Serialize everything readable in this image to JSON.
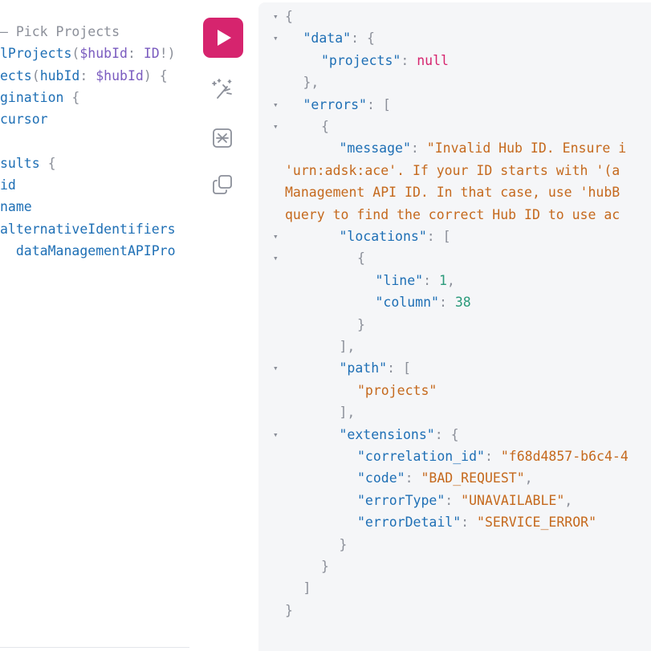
{
  "editor": {
    "lines": [
      {
        "segments": [
          {
            "t": "– Pick Projects",
            "c": "cmt"
          }
        ]
      },
      {
        "segments": [
          {
            "t": "lProjects",
            "c": "fn"
          },
          {
            "t": "(",
            "c": "p"
          },
          {
            "t": "$hubId",
            "c": "var"
          },
          {
            "t": ": ",
            "c": "p"
          },
          {
            "t": "ID",
            "c": "type"
          },
          {
            "t": "!)",
            "c": "p"
          }
        ]
      },
      {
        "segments": [
          {
            "t": "ects",
            "c": "field"
          },
          {
            "t": "(",
            "c": "p"
          },
          {
            "t": "hubId",
            "c": "field"
          },
          {
            "t": ": ",
            "c": "p"
          },
          {
            "t": "$hubId",
            "c": "var"
          },
          {
            "t": ") {",
            "c": "p"
          }
        ]
      },
      {
        "segments": [
          {
            "t": "gination",
            "c": "field"
          },
          {
            "t": " {",
            "c": "p"
          }
        ]
      },
      {
        "segments": [
          {
            "t": "cursor",
            "c": "field"
          }
        ]
      },
      {
        "segments": [
          {
            "t": "",
            "c": "p"
          }
        ]
      },
      {
        "segments": [
          {
            "t": "sults",
            "c": "field"
          },
          {
            "t": " {",
            "c": "p"
          }
        ]
      },
      {
        "segments": [
          {
            "t": "id",
            "c": "field"
          }
        ]
      },
      {
        "segments": [
          {
            "t": "name",
            "c": "field"
          }
        ]
      },
      {
        "segments": [
          {
            "t": "alternativeIdentifiers",
            "c": "field"
          }
        ]
      },
      {
        "segments": [
          {
            "t": "  dataManagementAPIPro",
            "c": "field"
          }
        ]
      },
      {
        "segments": [
          {
            "t": "",
            "c": "p"
          }
        ]
      }
    ]
  },
  "toolbar": {
    "run_icon": "play-icon",
    "prettify_icon": "magic-wand-icon",
    "merge_icon": "merge-fragments-icon",
    "copy_icon": "copy-icon"
  },
  "results": {
    "lines": [
      {
        "indent": 0,
        "fold": "▾",
        "segments": [
          {
            "t": "{",
            "c": "p"
          }
        ]
      },
      {
        "indent": 1,
        "fold": "▾",
        "segments": [
          {
            "t": "\"data\"",
            "c": "k"
          },
          {
            "t": ": {",
            "c": "p"
          }
        ]
      },
      {
        "indent": 2,
        "segments": [
          {
            "t": "\"projects\"",
            "c": "k"
          },
          {
            "t": ": ",
            "c": "p"
          },
          {
            "t": "null",
            "c": "kw"
          }
        ]
      },
      {
        "indent": 1,
        "segments": [
          {
            "t": "},",
            "c": "p"
          }
        ]
      },
      {
        "indent": 1,
        "fold": "▾",
        "segments": [
          {
            "t": "\"errors\"",
            "c": "k"
          },
          {
            "t": ": [",
            "c": "p"
          }
        ]
      },
      {
        "indent": 2,
        "fold": "▾",
        "segments": [
          {
            "t": "{",
            "c": "p"
          }
        ]
      },
      {
        "indent": 3,
        "segments": [
          {
            "t": "\"message\"",
            "c": "k"
          },
          {
            "t": ": ",
            "c": "p"
          },
          {
            "t": "\"Invalid Hub ID. Ensure i",
            "c": "s"
          }
        ]
      },
      {
        "indent": 0,
        "segments": [
          {
            "t": "'urn:adsk:ace'. If your ID starts with '(a",
            "c": "s"
          }
        ]
      },
      {
        "indent": 0,
        "segments": [
          {
            "t": "Management API ID. In that case, use 'hubB",
            "c": "s"
          }
        ]
      },
      {
        "indent": 0,
        "segments": [
          {
            "t": "query to find the correct Hub ID to use ac",
            "c": "s"
          }
        ]
      },
      {
        "indent": 3,
        "fold": "▾",
        "segments": [
          {
            "t": "\"locations\"",
            "c": "k"
          },
          {
            "t": ": [",
            "c": "p"
          }
        ]
      },
      {
        "indent": 4,
        "fold": "▾",
        "segments": [
          {
            "t": "{",
            "c": "p"
          }
        ]
      },
      {
        "indent": 5,
        "segments": [
          {
            "t": "\"line\"",
            "c": "k"
          },
          {
            "t": ": ",
            "c": "p"
          },
          {
            "t": "1",
            "c": "n"
          },
          {
            "t": ",",
            "c": "p"
          }
        ]
      },
      {
        "indent": 5,
        "segments": [
          {
            "t": "\"column\"",
            "c": "k"
          },
          {
            "t": ": ",
            "c": "p"
          },
          {
            "t": "38",
            "c": "n"
          }
        ]
      },
      {
        "indent": 4,
        "segments": [
          {
            "t": "}",
            "c": "p"
          }
        ]
      },
      {
        "indent": 3,
        "segments": [
          {
            "t": "],",
            "c": "p"
          }
        ]
      },
      {
        "indent": 3,
        "fold": "▾",
        "segments": [
          {
            "t": "\"path\"",
            "c": "k"
          },
          {
            "t": ": [",
            "c": "p"
          }
        ]
      },
      {
        "indent": 4,
        "segments": [
          {
            "t": "\"projects\"",
            "c": "s"
          }
        ]
      },
      {
        "indent": 3,
        "segments": [
          {
            "t": "],",
            "c": "p"
          }
        ]
      },
      {
        "indent": 3,
        "fold": "▾",
        "segments": [
          {
            "t": "\"extensions\"",
            "c": "k"
          },
          {
            "t": ": {",
            "c": "p"
          }
        ]
      },
      {
        "indent": 4,
        "segments": [
          {
            "t": "\"correlation_id\"",
            "c": "k"
          },
          {
            "t": ": ",
            "c": "p"
          },
          {
            "t": "\"f68d4857-b6c4-4",
            "c": "s"
          }
        ]
      },
      {
        "indent": 4,
        "segments": [
          {
            "t": "\"code\"",
            "c": "k"
          },
          {
            "t": ": ",
            "c": "p"
          },
          {
            "t": "\"BAD_REQUEST\"",
            "c": "s"
          },
          {
            "t": ",",
            "c": "p"
          }
        ]
      },
      {
        "indent": 4,
        "segments": [
          {
            "t": "\"errorType\"",
            "c": "k"
          },
          {
            "t": ": ",
            "c": "p"
          },
          {
            "t": "\"UNAVAILABLE\"",
            "c": "s"
          },
          {
            "t": ",",
            "c": "p"
          }
        ]
      },
      {
        "indent": 4,
        "segments": [
          {
            "t": "\"errorDetail\"",
            "c": "k"
          },
          {
            "t": ": ",
            "c": "p"
          },
          {
            "t": "\"SERVICE_ERROR\"",
            "c": "s"
          }
        ]
      },
      {
        "indent": 3,
        "segments": [
          {
            "t": "}",
            "c": "p"
          }
        ]
      },
      {
        "indent": 2,
        "segments": [
          {
            "t": "}",
            "c": "p"
          }
        ]
      },
      {
        "indent": 1,
        "segments": [
          {
            "t": "]",
            "c": "p"
          }
        ]
      },
      {
        "indent": 0,
        "segments": [
          {
            "t": "}",
            "c": "p"
          }
        ]
      }
    ]
  }
}
